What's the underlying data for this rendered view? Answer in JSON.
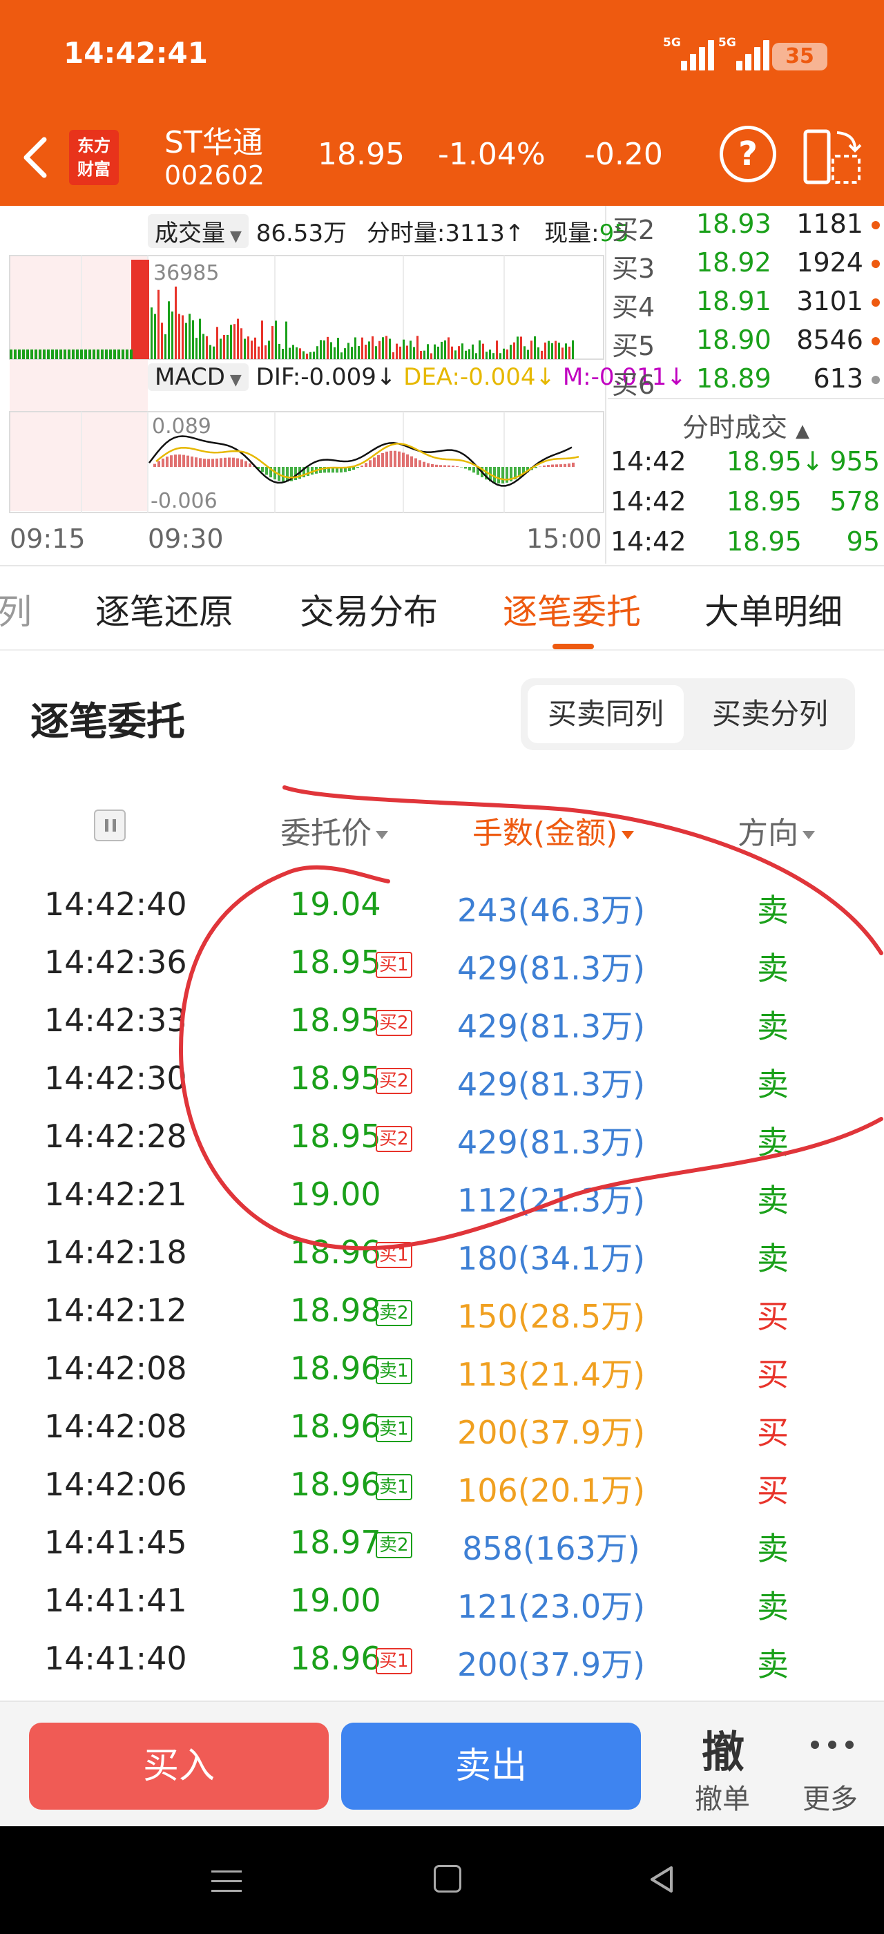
{
  "status": {
    "time": "14:42:41",
    "net1": "5G",
    "net2": "5G",
    "battery": "35"
  },
  "header": {
    "logo_line1": "东方",
    "logo_line2": "财富",
    "name": "ST华通",
    "code": "002602",
    "price": "18.95",
    "change_pct": "-1.04%",
    "change": "-0.20",
    "help": "?"
  },
  "chart": {
    "vol_indicator": "成交量",
    "vol_total": "86.53万",
    "vol_time": "分时量:3113↑",
    "vol_now_label": "现量:",
    "vol_now": "95",
    "vol_max": "36985",
    "macd_indicator": "MACD",
    "dif": "DIF:-0.009↓",
    "dea": "DEA:-0.004↓",
    "m": "M:-0.011↓",
    "macd_top": "0.089",
    "macd_bottom": "-0.006",
    "t_start": "09:15",
    "t_mid": "09:30",
    "t_end": "15:00",
    "colors": {
      "up": "#e8332a",
      "down": "#1aa01a",
      "dif": "#111111",
      "dea": "#e6b800",
      "m": "#c000c0"
    }
  },
  "book": [
    {
      "label": "买2",
      "price": "18.93",
      "vol": "1181",
      "dot": "#ee5a10"
    },
    {
      "label": "买3",
      "price": "18.92",
      "vol": "1924",
      "dot": "#ee5a10"
    },
    {
      "label": "买4",
      "price": "18.91",
      "vol": "3101",
      "dot": "#ee5a10"
    },
    {
      "label": "买5",
      "price": "18.90",
      "vol": "8546",
      "dot": "#ee5a10"
    },
    {
      "label": "买6",
      "price": "18.89",
      "vol": "613",
      "dot": "#999999"
    }
  ],
  "ticks": {
    "title": "分时成交",
    "rows": [
      {
        "time": "14:42",
        "price": "18.95↓",
        "vol": "955"
      },
      {
        "time": "14:42",
        "price": "18.95",
        "vol": "578"
      },
      {
        "time": "14:42",
        "price": "18.95",
        "vol": "95"
      }
    ]
  },
  "tabs": [
    "列",
    "逐笔还原",
    "交易分布",
    "逐笔委托",
    "大单明细"
  ],
  "active_tab": 3,
  "section": {
    "title": "逐笔委托",
    "seg_a": "买卖同列",
    "seg_b": "买卖分列"
  },
  "columns": {
    "price": "委托价",
    "vol": "手数(金额)",
    "dir": "方向"
  },
  "trades": [
    {
      "time": "14:42:40",
      "price": "19.04",
      "tag": "",
      "tag_type": "",
      "vol": "243(46.3万)",
      "dir": "卖"
    },
    {
      "time": "14:42:36",
      "price": "18.95",
      "tag": "买1",
      "tag_type": "buy",
      "vol": "429(81.3万)",
      "dir": "卖"
    },
    {
      "time": "14:42:33",
      "price": "18.95",
      "tag": "买2",
      "tag_type": "buy",
      "vol": "429(81.3万)",
      "dir": "卖"
    },
    {
      "time": "14:42:30",
      "price": "18.95",
      "tag": "买2",
      "tag_type": "buy",
      "vol": "429(81.3万)",
      "dir": "卖"
    },
    {
      "time": "14:42:28",
      "price": "18.95",
      "tag": "买2",
      "tag_type": "buy",
      "vol": "429(81.3万)",
      "dir": "卖"
    },
    {
      "time": "14:42:21",
      "price": "19.00",
      "tag": "",
      "tag_type": "",
      "vol": "112(21.3万)",
      "dir": "卖"
    },
    {
      "time": "14:42:18",
      "price": "18.96",
      "tag": "买1",
      "tag_type": "buy",
      "vol": "180(34.1万)",
      "dir": "卖"
    },
    {
      "time": "14:42:12",
      "price": "18.98",
      "tag": "卖2",
      "tag_type": "sell",
      "vol": "150(28.5万)",
      "dir": "买"
    },
    {
      "time": "14:42:08",
      "price": "18.96",
      "tag": "卖1",
      "tag_type": "sell",
      "vol": "113(21.4万)",
      "dir": "买"
    },
    {
      "time": "14:42:08",
      "price": "18.96",
      "tag": "卖1",
      "tag_type": "sell",
      "vol": "200(37.9万)",
      "dir": "买"
    },
    {
      "time": "14:42:06",
      "price": "18.96",
      "tag": "卖1",
      "tag_type": "sell",
      "vol": "106(20.1万)",
      "dir": "买"
    },
    {
      "time": "14:41:45",
      "price": "18.97",
      "tag": "卖2",
      "tag_type": "sell",
      "vol": "858(163万)",
      "dir": "卖"
    },
    {
      "time": "14:41:41",
      "price": "19.00",
      "tag": "",
      "tag_type": "",
      "vol": "121(23.0万)",
      "dir": "卖"
    },
    {
      "time": "14:41:40",
      "price": "18.96",
      "tag": "买1",
      "tag_type": "buy",
      "vol": "200(37.9万)",
      "dir": "卖"
    }
  ],
  "bottom": {
    "buy": "买入",
    "sell": "卖出",
    "cancel_icon": "撤",
    "cancel": "撤单",
    "more": "更多"
  },
  "colors": {
    "accent": "#ee5a10",
    "green": "#1aa01a",
    "red": "#e8332a",
    "blue": "#3e84f0",
    "buy_btn": "#f05b55",
    "sell_btn": "#3e84f0",
    "vol_sell": "#3d7fd4",
    "vol_buy": "#f0a020"
  },
  "icons": [
    "back-arrow-icon",
    "help-icon",
    "rotate-screen-icon",
    "pause-icon",
    "more-dots-icon",
    "nav-menu-icon",
    "nav-home-icon",
    "nav-back-icon",
    "signal-icon",
    "battery-icon"
  ]
}
